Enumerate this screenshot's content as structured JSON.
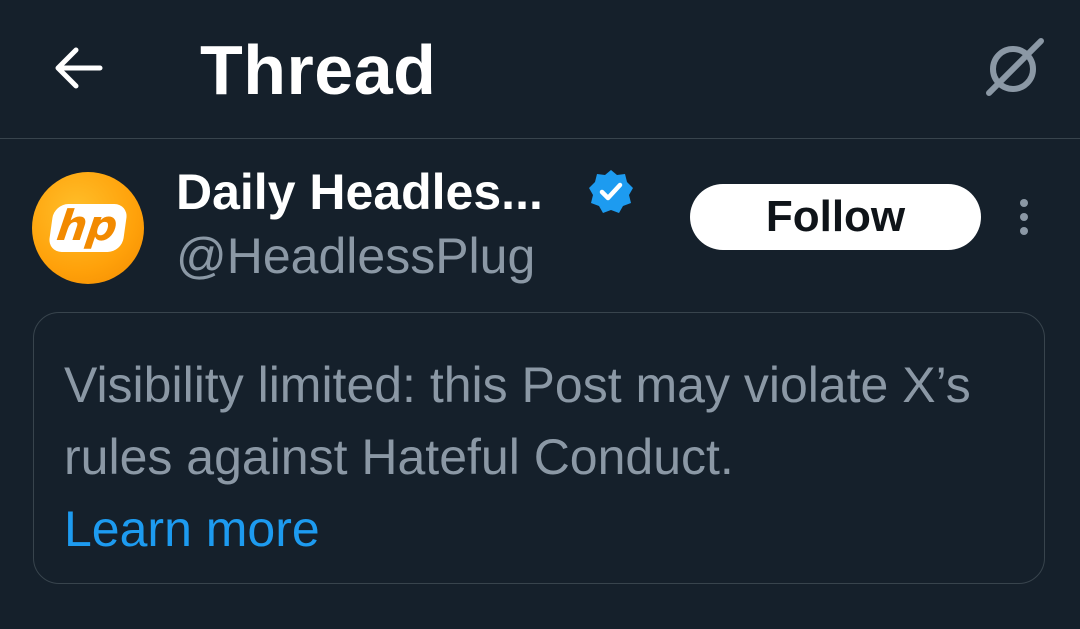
{
  "header": {
    "title": "Thread",
    "back_icon": "arrow-left-icon",
    "grok_icon": "grok-icon"
  },
  "post": {
    "author": {
      "display_name": "Daily Headles...",
      "handle": "@HeadlessPlug",
      "avatar_text": "hp",
      "verified": true,
      "avatar_color": "#ffa10a"
    },
    "follow_label": "Follow",
    "more_icon": "more-vertical-icon",
    "notice": {
      "text": "Visibility limited: this Post may violate X’s rules against Hateful Conduct.",
      "link_label": "Learn more"
    }
  },
  "colors": {
    "background": "#15202b",
    "border": "#38444d",
    "muted_text": "#8b98a5",
    "accent": "#1d9bf0",
    "verified_badge": "#1d9bf0"
  }
}
